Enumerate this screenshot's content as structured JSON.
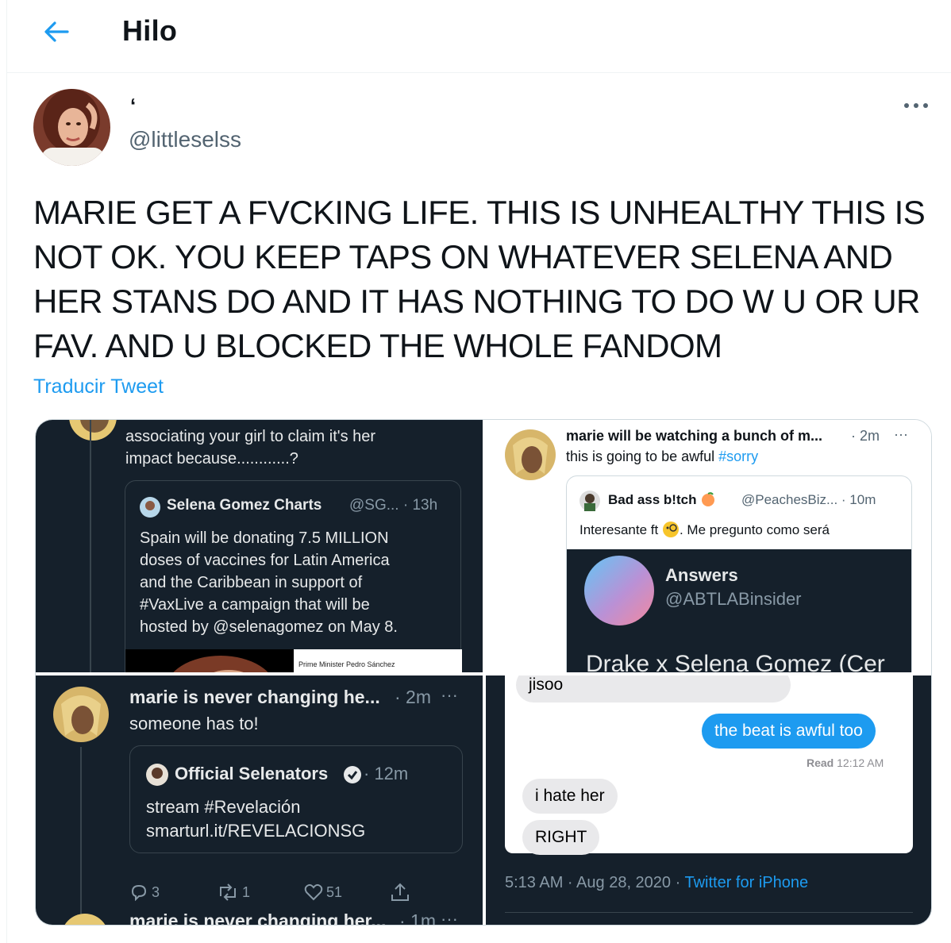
{
  "header": {
    "title": "Hilo",
    "back_icon": "arrow-left-icon"
  },
  "tweet": {
    "display_name": "ʻ",
    "handle": "@littleselss",
    "text": "MARIE GET A FVCKING LIFE. THIS IS UNHEALTHY THIS IS NOT OK. YOU KEEP TAPS ON WHATEVER SELENA AND HER STANS DO AND IT HAS NOTHING TO DO W U OR UR FAV. AND U BLOCKED THE WHOLE FANDOM",
    "translate_label": "Traducir Tweet"
  },
  "media": {
    "panel1": {
      "text_line1": "associating your girl to claim it's her",
      "text_line2": "impact because............?",
      "quote_name": "Selena Gomez Charts",
      "quote_meta": "@SG... · 13h",
      "quote_lines": [
        "Spain will be donating 7.5 MILLION",
        "doses of vaccines for Latin America",
        "and the Caribbean in support of",
        "#VaxLive a campaign that will be",
        "hosted by @selenagomez on May 8."
      ],
      "image_caption": "Prime Minister Pedro Sánchez"
    },
    "panel2": {
      "name": "marie will be watching a bunch of m...",
      "meta": "· 2m",
      "text": "this is going to be awful",
      "hashtag": "#sorry",
      "quote_name": "Bad ass b!tch",
      "quote_meta": "@PeachesBiz... · 10m",
      "quote_text1": "Interesante ft",
      "quote_text2": ". Me pregunto como será",
      "card_title": "Answers",
      "card_handle": "@ABTLABinsider",
      "card_text": "Drake x Selena Gomez (Cer"
    },
    "panel3": {
      "name": "marie is never changing he...",
      "meta": "· 2m",
      "text": "someone has to!",
      "quote_name": "Official Selenators",
      "quote_meta": "· 12m",
      "quote_line1": "stream #Revelación",
      "quote_line2": "smarturl.it/REVELACIONSG",
      "replies": "3",
      "retweets": "1",
      "likes": "51",
      "next_name": "marie is never changing her...",
      "next_meta": "· 1m"
    },
    "panel4": {
      "msg_top": "jisoo",
      "msg_sent": "the beat is awful too",
      "read_label": "Read",
      "read_time": "12:12 AM",
      "msg_hate": "i hate her",
      "msg_right": "RIGHT",
      "timestamp": "5:13 AM · Aug 28, 2020 ·",
      "source": "Twitter for iPhone"
    }
  },
  "colors": {
    "accent": "#1d9bf0",
    "dark_bg": "#15202b",
    "muted": "#8899a6"
  }
}
